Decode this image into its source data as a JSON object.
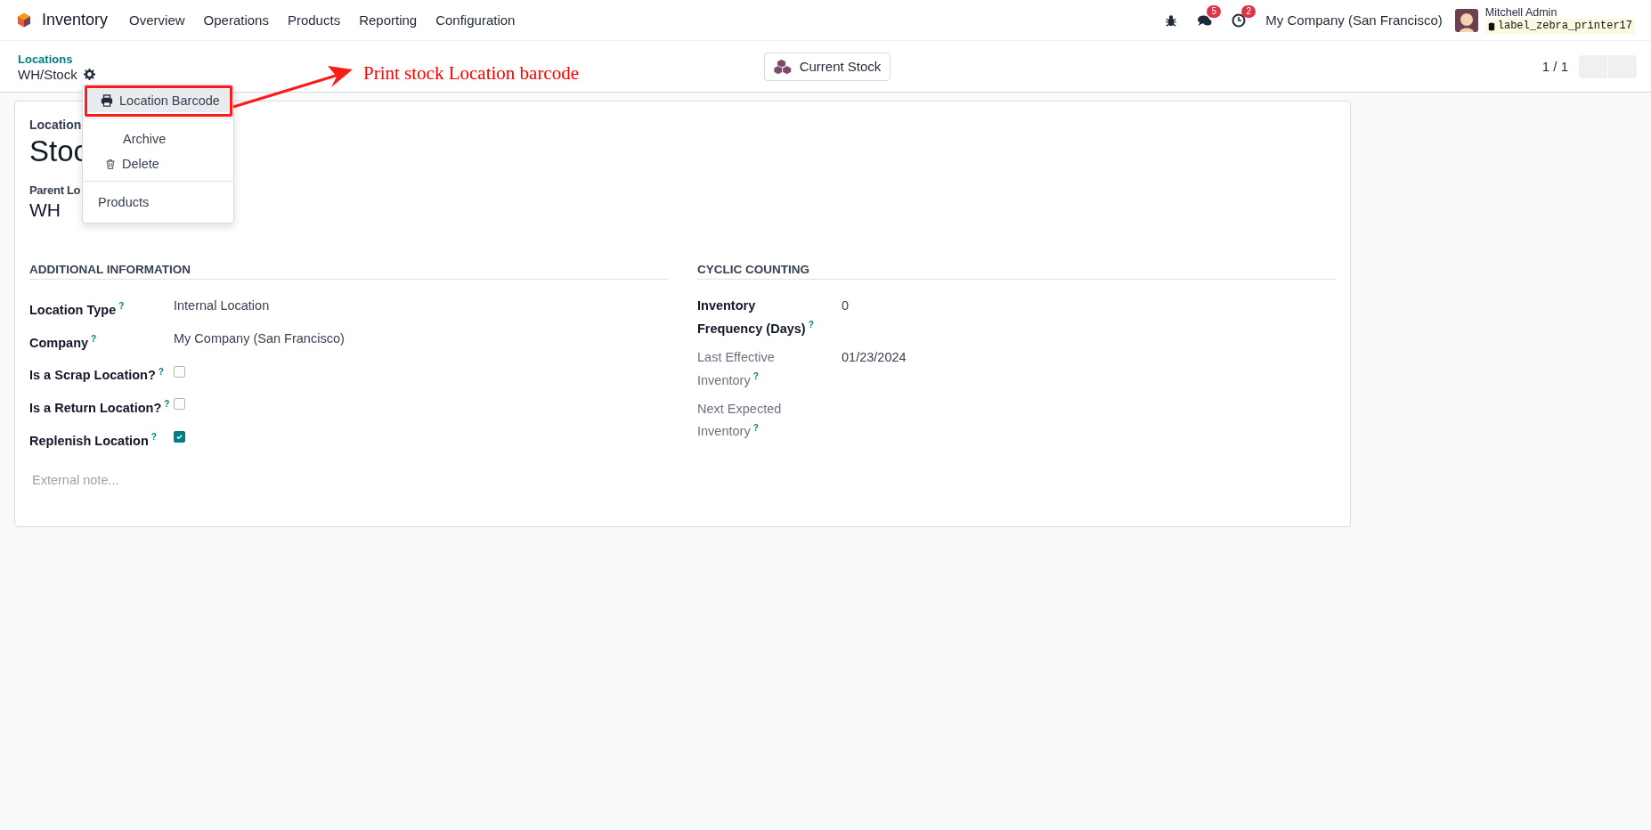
{
  "navbar": {
    "app": "Inventory",
    "menu": [
      {
        "label": "Overview"
      },
      {
        "label": "Operations"
      },
      {
        "label": "Products"
      },
      {
        "label": "Reporting"
      },
      {
        "label": "Configuration"
      }
    ]
  },
  "systray": {
    "messages_badge": "5",
    "activities_badge": "2",
    "company": "My Company (San Francisco)",
    "user": "Mitchell Admin",
    "database": "label_zebra_printer17"
  },
  "breadcrumb": {
    "parent": "Locations",
    "current": "WH/Stock"
  },
  "smart_buttons": [
    {
      "label": "Current Stock"
    }
  ],
  "pager": {
    "value": "1 / 1"
  },
  "action_menu": {
    "groups": [
      [
        {
          "kind": "print",
          "label": "Location Barcode",
          "selected": true
        }
      ],
      [
        {
          "kind": "plain",
          "label": "Archive",
          "selected": false
        },
        {
          "kind": "delete",
          "label": "Delete",
          "selected": false
        }
      ],
      [
        {
          "kind": "link",
          "label": "Products",
          "selected": false
        }
      ]
    ]
  },
  "annotation": {
    "text": "Print stock Location barcode"
  },
  "form": {
    "name_label": "Location",
    "name": "Stoc",
    "parent_label": "Parent Lo",
    "parent": "WH",
    "sections": [
      {
        "title": "ADDITIONAL INFORMATION",
        "fields": [
          {
            "kind": "text",
            "label": "Location Type",
            "help": "?",
            "readonly": false,
            "value": "Internal Location"
          },
          {
            "kind": "text",
            "label": "Company",
            "help": "?",
            "readonly": false,
            "value": "My Company (San Francisco)"
          },
          {
            "kind": "checkbox",
            "label": "Is a Scrap Location?",
            "help": "?",
            "readonly": false,
            "checked": false
          },
          {
            "kind": "checkbox",
            "label": "Is a Return Location?",
            "help": "?",
            "readonly": false,
            "checked": false
          },
          {
            "kind": "checkbox",
            "label": "Replenish Location",
            "help": "?",
            "readonly": false,
            "checked": true
          }
        ],
        "note_placeholder": "External note..."
      },
      {
        "title": "CYCLIC COUNTING",
        "fields": [
          {
            "kind": "text",
            "label": "Inventory Frequency (Days)",
            "help": "?",
            "readonly": false,
            "value": "0"
          },
          {
            "kind": "text",
            "label": "Last Effective Inventory",
            "help": "?",
            "readonly": true,
            "value": "01/23/2024"
          },
          {
            "kind": "text",
            "label": "Next Expected Inventory",
            "help": "?",
            "readonly": true
          }
        ]
      }
    ]
  }
}
